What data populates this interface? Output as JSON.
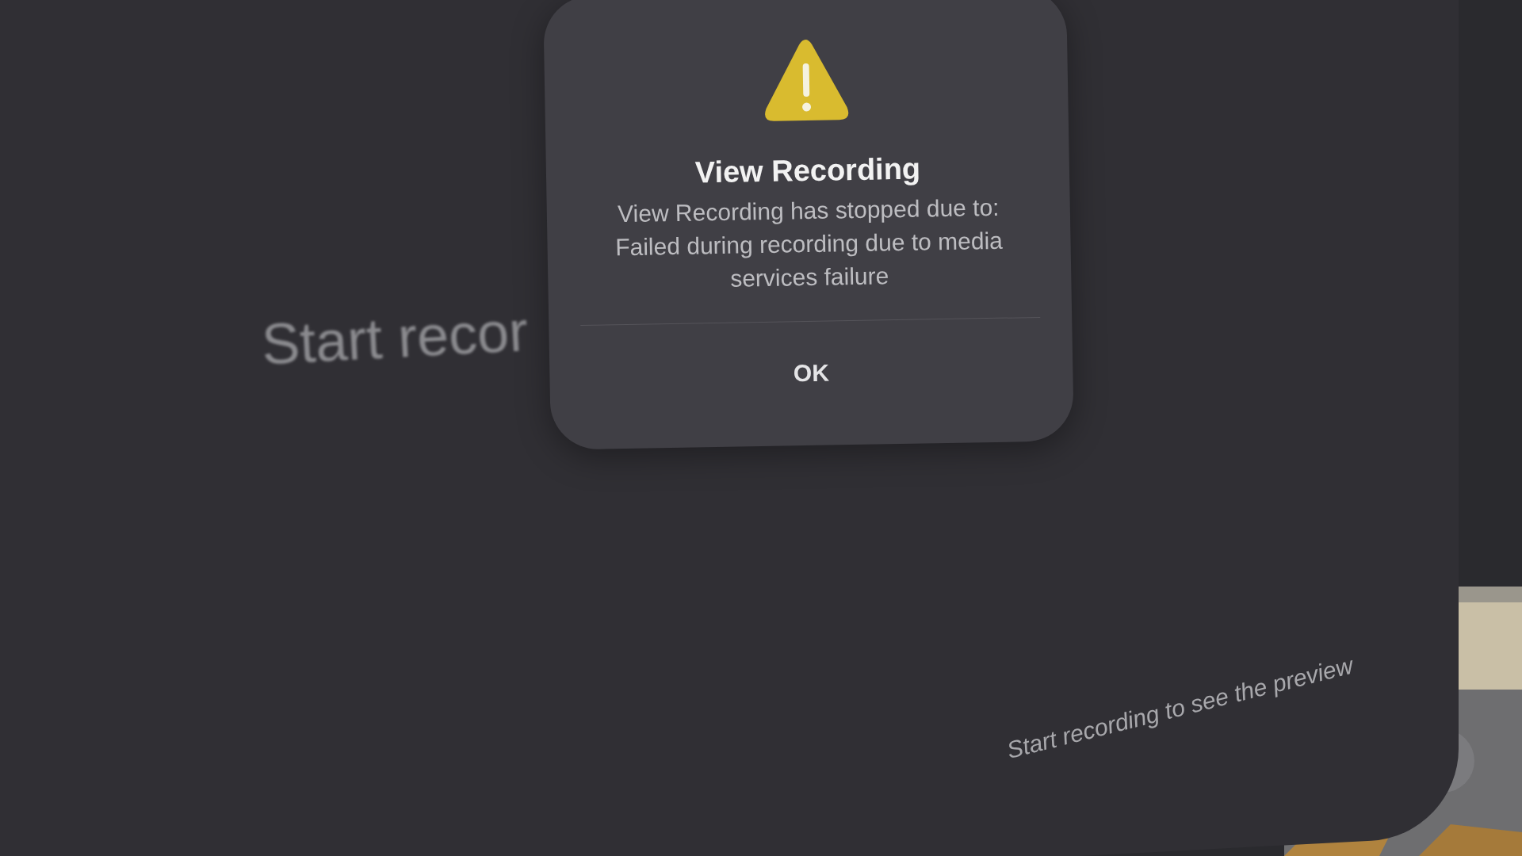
{
  "background_window": {
    "placeholder_text": "Start recor",
    "preview_hint": "Start recording to see the preview"
  },
  "alert": {
    "title": "View Recording",
    "message": "View Recording has stopped due to: Failed during recording due to media services failure",
    "buttons": [
      "OK"
    ]
  }
}
